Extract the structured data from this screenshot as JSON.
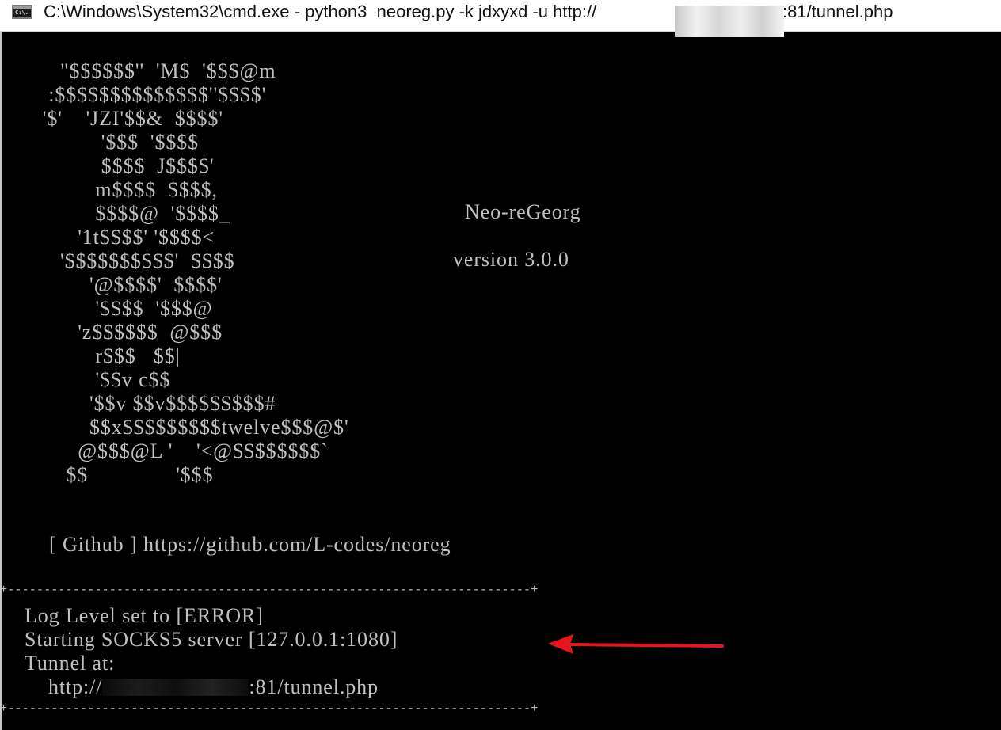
{
  "window": {
    "title_prefix": "C:\\Windows\\System32\\cmd.exe - python3  neoreg.py -k jdxyxd -u http://",
    "title_suffix": ":81/tunnel.php",
    "icon_text": "C:\\."
  },
  "console": {
    "ascii_art": "          \"$$$$$$''  'M$  '$$$@m\n        :$$$$$$$$$$$$$$''$$$$'\n       '$'    'JZI'$$&  $$$$'\n                 '$$$  '$$$$\n                 $$$$  J$$$$'\n                m$$$$  $$$$,\n                $$$$@  '$$$$_\n             '1t$$$$' '$$$$<\n          '$$$$$$$$$$'  $$$$\n               '@$$$$'  $$$$'\n                '$$$$  '$$$@\n             'z$$$$$$  @$$$\n                r$$$   $$|\n                '$$v c$$\n               '$$v $$v$$$$$$$$$#\n               $$x$$$$$$$$$twelve$$$@$'\n             @$$$@L '    '<@$$$$$$$$`\n           $$               '$$$",
    "brand_name": "Neo-reGeorg",
    "brand_version": "version 3.0.0",
    "github_line": "[ Github ] https://github.com/L-codes/neoreg",
    "rule": "+------------------------------------------------------------------------+",
    "log": {
      "line1": "Log Level set to [ERROR]",
      "line2": "Starting SOCKS5 server [127.0.0.1:1080]",
      "line3": "Tunnel at:",
      "line4_prefix": "http://",
      "line4_suffix": ":81/tunnel.php"
    }
  },
  "annotation": {
    "arrow_color": "#e8141c"
  },
  "colors": {
    "console_bg": "#000000",
    "console_fg": "#c0c0c0",
    "titlebar_bg": "#ffffff"
  }
}
